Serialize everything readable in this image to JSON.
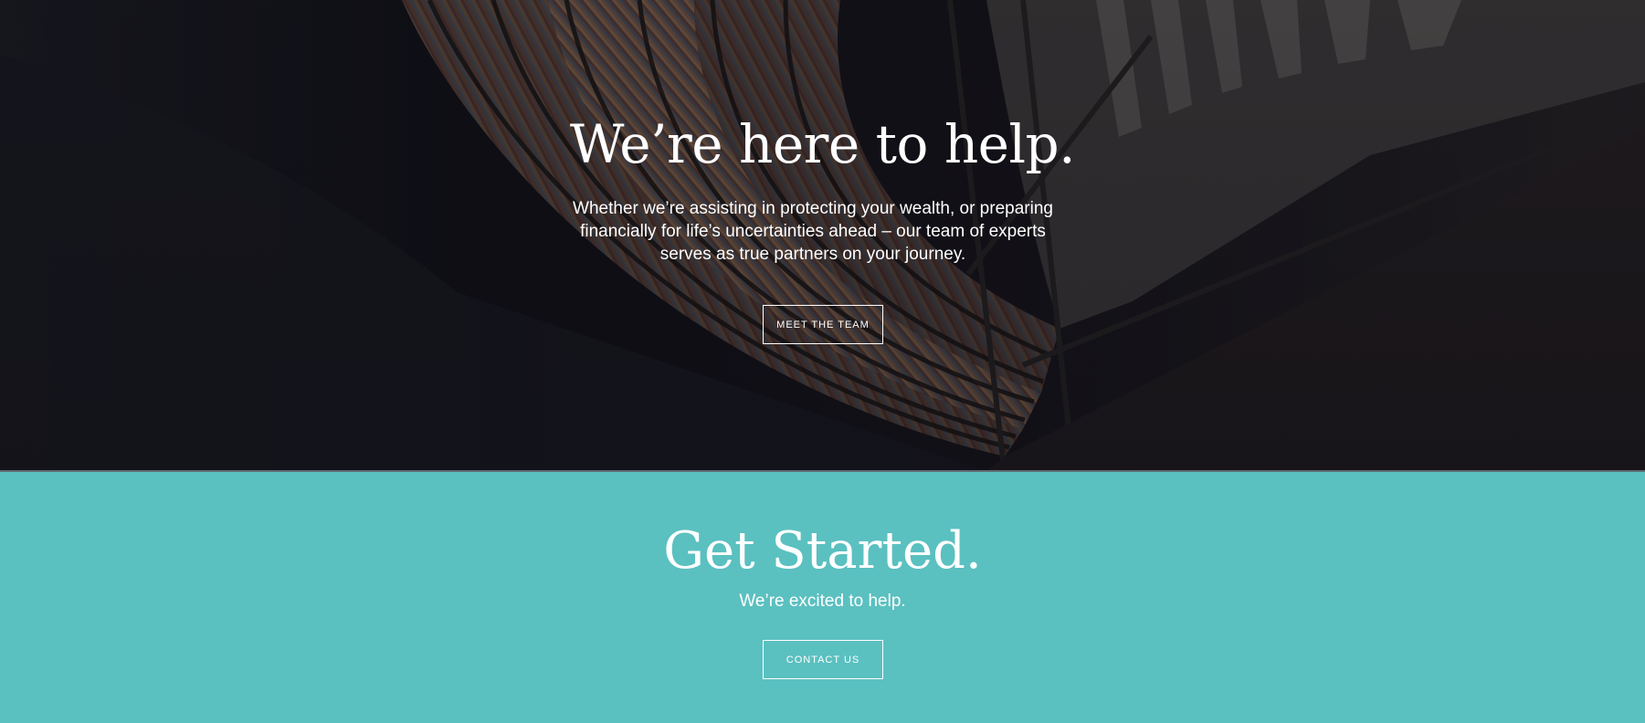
{
  "hero": {
    "title": "We’re here to help.",
    "text": "Whether we’re assisting in protecting your wealth, or preparing financially for life’s uncertainties ahead – our team of experts serves as true partners on your journey.",
    "button_label": "MEET THE TEAM"
  },
  "get_started": {
    "title": "Get Started.",
    "subtitle": "We’re excited to help.",
    "button_label": "CONTACT US"
  },
  "colors": {
    "accent": "#5bc0c0",
    "hero_overlay": "#0e0e14",
    "text": "#ffffff"
  }
}
